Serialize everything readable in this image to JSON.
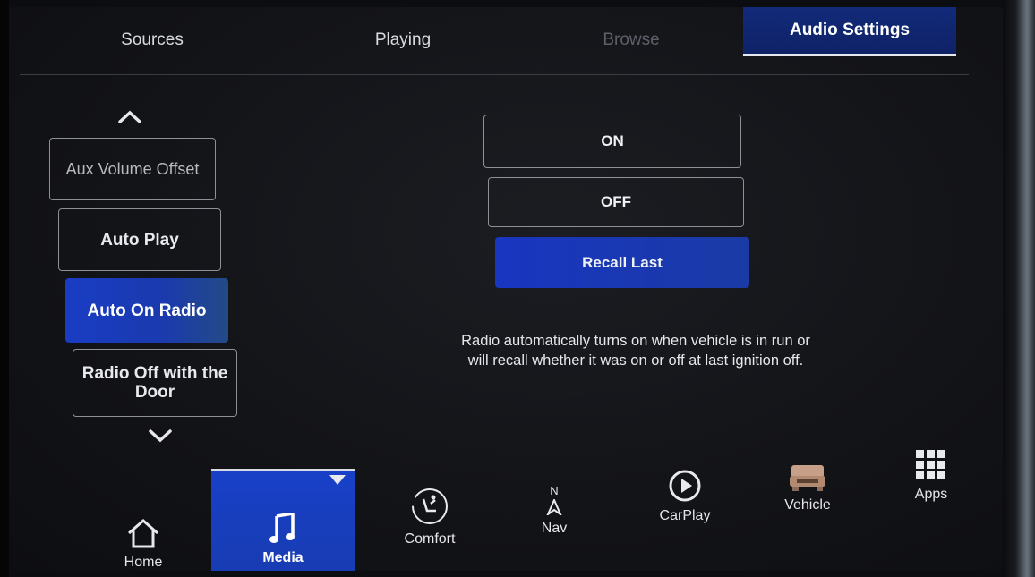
{
  "tabs": [
    {
      "label": "Sources"
    },
    {
      "label": "Playing"
    },
    {
      "label": "Browse"
    },
    {
      "label": "Audio Settings"
    }
  ],
  "settings_list": {
    "items": [
      {
        "label": "Aux Volume Offset"
      },
      {
        "label": "Auto Play"
      },
      {
        "label": "Auto On Radio"
      },
      {
        "label": "Radio Off with the Door"
      }
    ],
    "up_icon": "chevron-up-icon",
    "down_icon": "chevron-down-icon"
  },
  "options": {
    "on": "ON",
    "off": "OFF",
    "recall_last": "Recall Last",
    "selected": "Recall Last"
  },
  "description": "Radio automatically turns on when vehicle is in run or will recall whether it was on or off at last ignition off.",
  "bottom_nav": {
    "items": [
      {
        "label": "Home",
        "icon": "home-icon"
      },
      {
        "label": "Media",
        "icon": "music-note-icon"
      },
      {
        "label": "Comfort",
        "icon": "seat-icon"
      },
      {
        "label": "Nav",
        "icon": "compass-icon",
        "compass_letter": "N"
      },
      {
        "label": "CarPlay",
        "icon": "carplay-icon"
      },
      {
        "label": "Vehicle",
        "icon": "vehicle-icon"
      },
      {
        "label": "Apps",
        "icon": "apps-grid-icon"
      }
    ]
  },
  "colors": {
    "accent_blue": "#1a3cc4",
    "background": "#131418",
    "text": "#e8e9ec"
  }
}
